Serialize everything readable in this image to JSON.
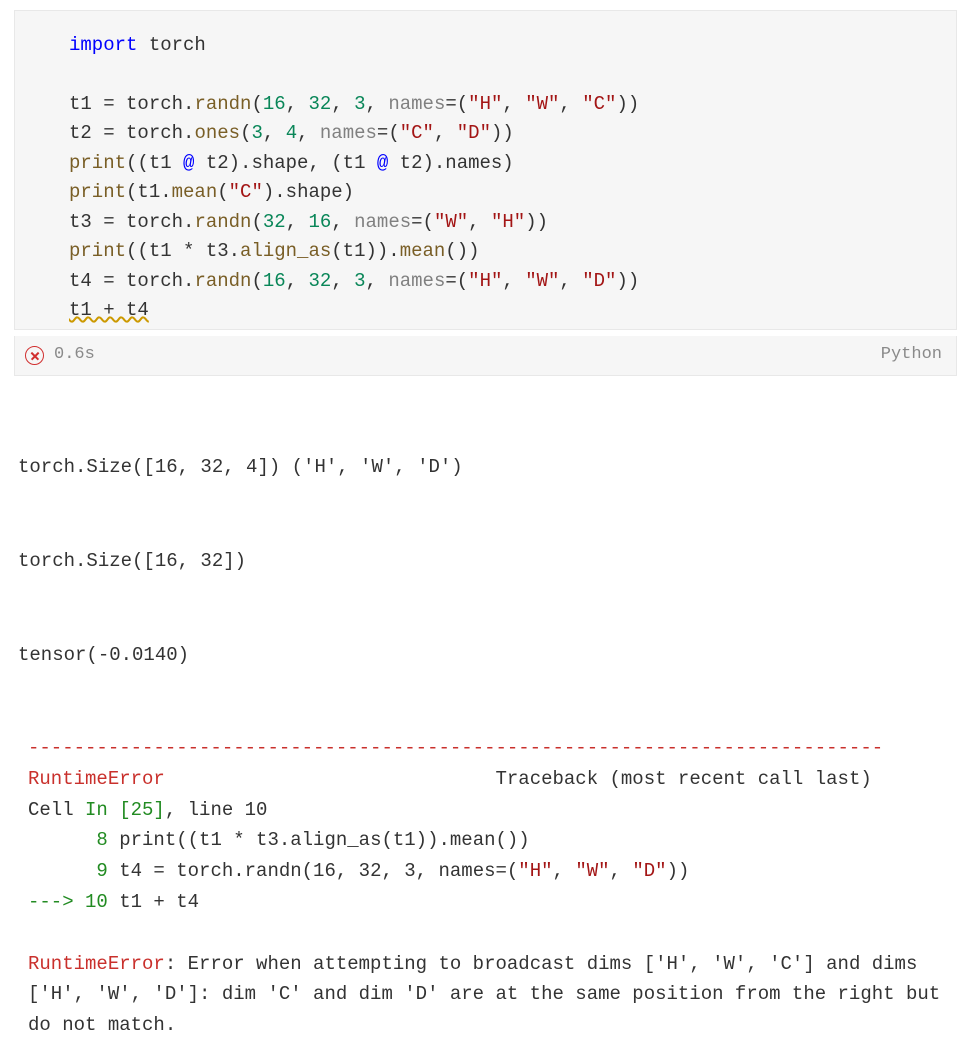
{
  "code_lines": [
    [
      {
        "t": "import ",
        "c": "tk-kw"
      },
      {
        "t": "torch",
        "c": ""
      }
    ],
    [],
    [
      {
        "t": "t1 ",
        "c": ""
      },
      {
        "t": "=",
        "c": "tk-op"
      },
      {
        "t": " torch.",
        "c": ""
      },
      {
        "t": "randn",
        "c": "tk-fn"
      },
      {
        "t": "(",
        "c": ""
      },
      {
        "t": "16",
        "c": "tk-num"
      },
      {
        "t": ", ",
        "c": ""
      },
      {
        "t": "32",
        "c": "tk-num"
      },
      {
        "t": ", ",
        "c": ""
      },
      {
        "t": "3",
        "c": "tk-num"
      },
      {
        "t": ", ",
        "c": ""
      },
      {
        "t": "names",
        "c": "tk-name"
      },
      {
        "t": "=",
        "c": "tk-op"
      },
      {
        "t": "(",
        "c": ""
      },
      {
        "t": "\"H\"",
        "c": "tk-str"
      },
      {
        "t": ", ",
        "c": ""
      },
      {
        "t": "\"W\"",
        "c": "tk-str"
      },
      {
        "t": ", ",
        "c": ""
      },
      {
        "t": "\"C\"",
        "c": "tk-str"
      },
      {
        "t": "))",
        "c": ""
      }
    ],
    [
      {
        "t": "t2 ",
        "c": ""
      },
      {
        "t": "=",
        "c": "tk-op"
      },
      {
        "t": " torch.",
        "c": ""
      },
      {
        "t": "ones",
        "c": "tk-fn"
      },
      {
        "t": "(",
        "c": ""
      },
      {
        "t": "3",
        "c": "tk-num"
      },
      {
        "t": ", ",
        "c": ""
      },
      {
        "t": "4",
        "c": "tk-num"
      },
      {
        "t": ", ",
        "c": ""
      },
      {
        "t": "names",
        "c": "tk-name"
      },
      {
        "t": "=",
        "c": "tk-op"
      },
      {
        "t": "(",
        "c": ""
      },
      {
        "t": "\"C\"",
        "c": "tk-str"
      },
      {
        "t": ", ",
        "c": ""
      },
      {
        "t": "\"D\"",
        "c": "tk-str"
      },
      {
        "t": "))",
        "c": ""
      }
    ],
    [
      {
        "t": "print",
        "c": "tk-fn"
      },
      {
        "t": "((t1 ",
        "c": ""
      },
      {
        "t": "@",
        "c": "tk-opkw"
      },
      {
        "t": " t2).shape, (t1 ",
        "c": ""
      },
      {
        "t": "@",
        "c": "tk-opkw"
      },
      {
        "t": " t2).names)",
        "c": ""
      }
    ],
    [
      {
        "t": "print",
        "c": "tk-fn"
      },
      {
        "t": "(t1.",
        "c": ""
      },
      {
        "t": "mean",
        "c": "tk-fn"
      },
      {
        "t": "(",
        "c": ""
      },
      {
        "t": "\"C\"",
        "c": "tk-str"
      },
      {
        "t": ").shape)",
        "c": ""
      }
    ],
    [
      {
        "t": "t3 ",
        "c": ""
      },
      {
        "t": "=",
        "c": "tk-op"
      },
      {
        "t": " torch.",
        "c": ""
      },
      {
        "t": "randn",
        "c": "tk-fn"
      },
      {
        "t": "(",
        "c": ""
      },
      {
        "t": "32",
        "c": "tk-num"
      },
      {
        "t": ", ",
        "c": ""
      },
      {
        "t": "16",
        "c": "tk-num"
      },
      {
        "t": ", ",
        "c": ""
      },
      {
        "t": "names",
        "c": "tk-name"
      },
      {
        "t": "=",
        "c": "tk-op"
      },
      {
        "t": "(",
        "c": ""
      },
      {
        "t": "\"W\"",
        "c": "tk-str"
      },
      {
        "t": ", ",
        "c": ""
      },
      {
        "t": "\"H\"",
        "c": "tk-str"
      },
      {
        "t": "))",
        "c": ""
      }
    ],
    [
      {
        "t": "print",
        "c": "tk-fn"
      },
      {
        "t": "((t1 ",
        "c": ""
      },
      {
        "t": "*",
        "c": "tk-op"
      },
      {
        "t": " t3.",
        "c": ""
      },
      {
        "t": "align_as",
        "c": "tk-fn"
      },
      {
        "t": "(t1)).",
        "c": ""
      },
      {
        "t": "mean",
        "c": "tk-fn"
      },
      {
        "t": "())",
        "c": ""
      }
    ],
    [
      {
        "t": "t4 ",
        "c": ""
      },
      {
        "t": "=",
        "c": "tk-op"
      },
      {
        "t": " torch.",
        "c": ""
      },
      {
        "t": "randn",
        "c": "tk-fn"
      },
      {
        "t": "(",
        "c": ""
      },
      {
        "t": "16",
        "c": "tk-num"
      },
      {
        "t": ", ",
        "c": ""
      },
      {
        "t": "32",
        "c": "tk-num"
      },
      {
        "t": ", ",
        "c": ""
      },
      {
        "t": "3",
        "c": "tk-num"
      },
      {
        "t": ", ",
        "c": ""
      },
      {
        "t": "names",
        "c": "tk-name"
      },
      {
        "t": "=",
        "c": "tk-op"
      },
      {
        "t": "(",
        "c": ""
      },
      {
        "t": "\"H\"",
        "c": "tk-str"
      },
      {
        "t": ", ",
        "c": ""
      },
      {
        "t": "\"W\"",
        "c": "tk-str"
      },
      {
        "t": ", ",
        "c": ""
      },
      {
        "t": "\"D\"",
        "c": "tk-str"
      },
      {
        "t": "))",
        "c": ""
      }
    ],
    [
      {
        "t": "t1 + t4",
        "c": "squiggle"
      }
    ]
  ],
  "status": {
    "time": "0.6s",
    "kernel": "Python"
  },
  "stdout": [
    "torch.Size([16, 32, 4]) ('H', 'W', 'D')",
    "torch.Size([16, 32])",
    "tensor(-0.0140)"
  ],
  "traceback": {
    "dashes1": "---------------------------------------------------------------------------",
    "errname": "RuntimeError",
    "trace_hdr": "                             Traceback (most recent call last)",
    "cell_pre": "Cell ",
    "cell_id": "In [25]",
    "cell_post": ", line 10",
    "l8_no": "      8",
    "l9_no": "      9",
    "l10_arrow": "---> ",
    "l10_no": "10",
    "l8_txt_a": " print((t1 * t3.align_as(t1)).mean())",
    "l9_txt_a": " t4 = torch.randn(16, 32, 3, names=(",
    "l9_str1": "\"H\"",
    "l9_c1": ", ",
    "l9_str2": "\"W\"",
    "l9_c2": ", ",
    "l9_str3": "\"D\"",
    "l9_end": "))",
    "l10_txt": " t1 + t4",
    "msg": ": Error when attempting to broadcast dims ['H', 'W', 'C'] and dims ['H', 'W', 'D']: dim 'C' and dim 'D' are at the same position from the right but do not match."
  }
}
